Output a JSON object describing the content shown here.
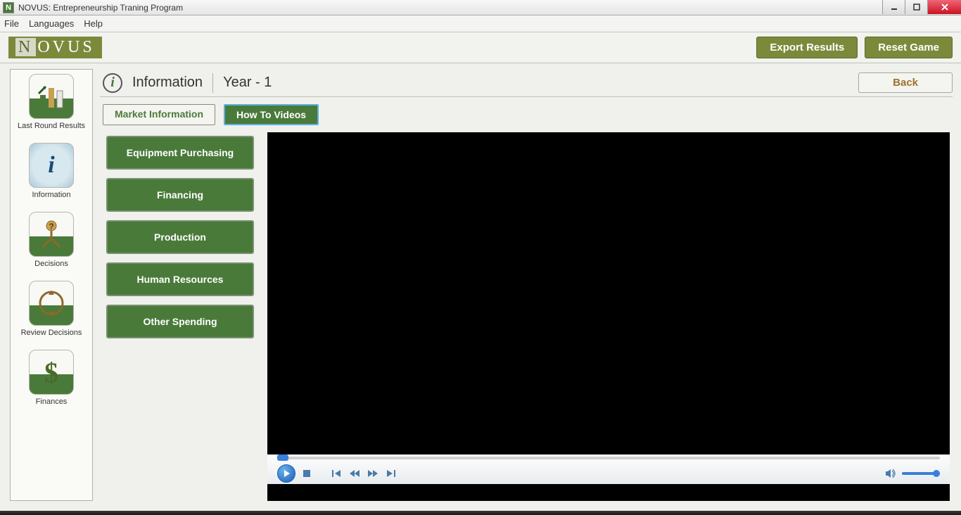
{
  "window": {
    "title": "NOVUS: Entrepreneurship Traning Program"
  },
  "menubar": {
    "file": "File",
    "languages": "Languages",
    "help": "Help"
  },
  "header": {
    "logo": "NOVUS",
    "export": "Export Results",
    "reset": "Reset Game"
  },
  "sidebar": {
    "items": [
      {
        "label": "Last Round Results"
      },
      {
        "label": "Information"
      },
      {
        "label": "Decisions"
      },
      {
        "label": "Review Decisions"
      },
      {
        "label": "Finances"
      }
    ]
  },
  "content": {
    "title": "Information",
    "year": "Year - 1",
    "back": "Back"
  },
  "tabs": {
    "market": "Market Information",
    "howto": "How To Videos"
  },
  "videoList": [
    "Equipment Purchasing",
    "Financing",
    "Production",
    "Human Resources",
    "Other Spending"
  ]
}
